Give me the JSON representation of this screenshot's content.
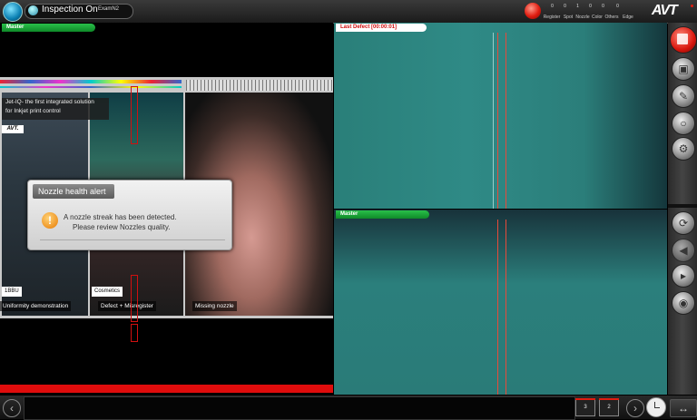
{
  "topbar": {
    "status": "Inspection On",
    "job": "ExamN2",
    "brand": "AVT",
    "counters": [
      {
        "label": "Register",
        "value": "0"
      },
      {
        "label": "Spot",
        "value": "0"
      },
      {
        "label": "Nozzle",
        "value": "1"
      },
      {
        "label": "Color",
        "value": "0"
      },
      {
        "label": "Others",
        "value": "0"
      },
      {
        "label": "Edge",
        "value": "0"
      }
    ]
  },
  "panels": {
    "master": "Master",
    "last_defect": "Last Defect [00:00:01]",
    "master_bottom": "Master"
  },
  "print_image": {
    "caption_line1": "Jet-IQ- the first integrated solution",
    "caption_line2": "for Inkjet print control",
    "logo_small": "AVT.",
    "tag1": "1BBU",
    "tag2": "Cosmetics",
    "caption1": "Uniformity demonstration",
    "caption2": "Defect + Misregister",
    "caption3": "Missing nozzle"
  },
  "alert": {
    "title": "Nozzle health alert",
    "line1": "A nozzle streak has been detected.",
    "line2": "Please review Nozzles quality.",
    "icon": "warning-icon"
  },
  "bottombar": {
    "box1": "3",
    "box2": "2"
  },
  "colors": {
    "accent_green": "#1fa63c",
    "alarm_red": "#e01c10",
    "brand_red": "#e01c10"
  }
}
